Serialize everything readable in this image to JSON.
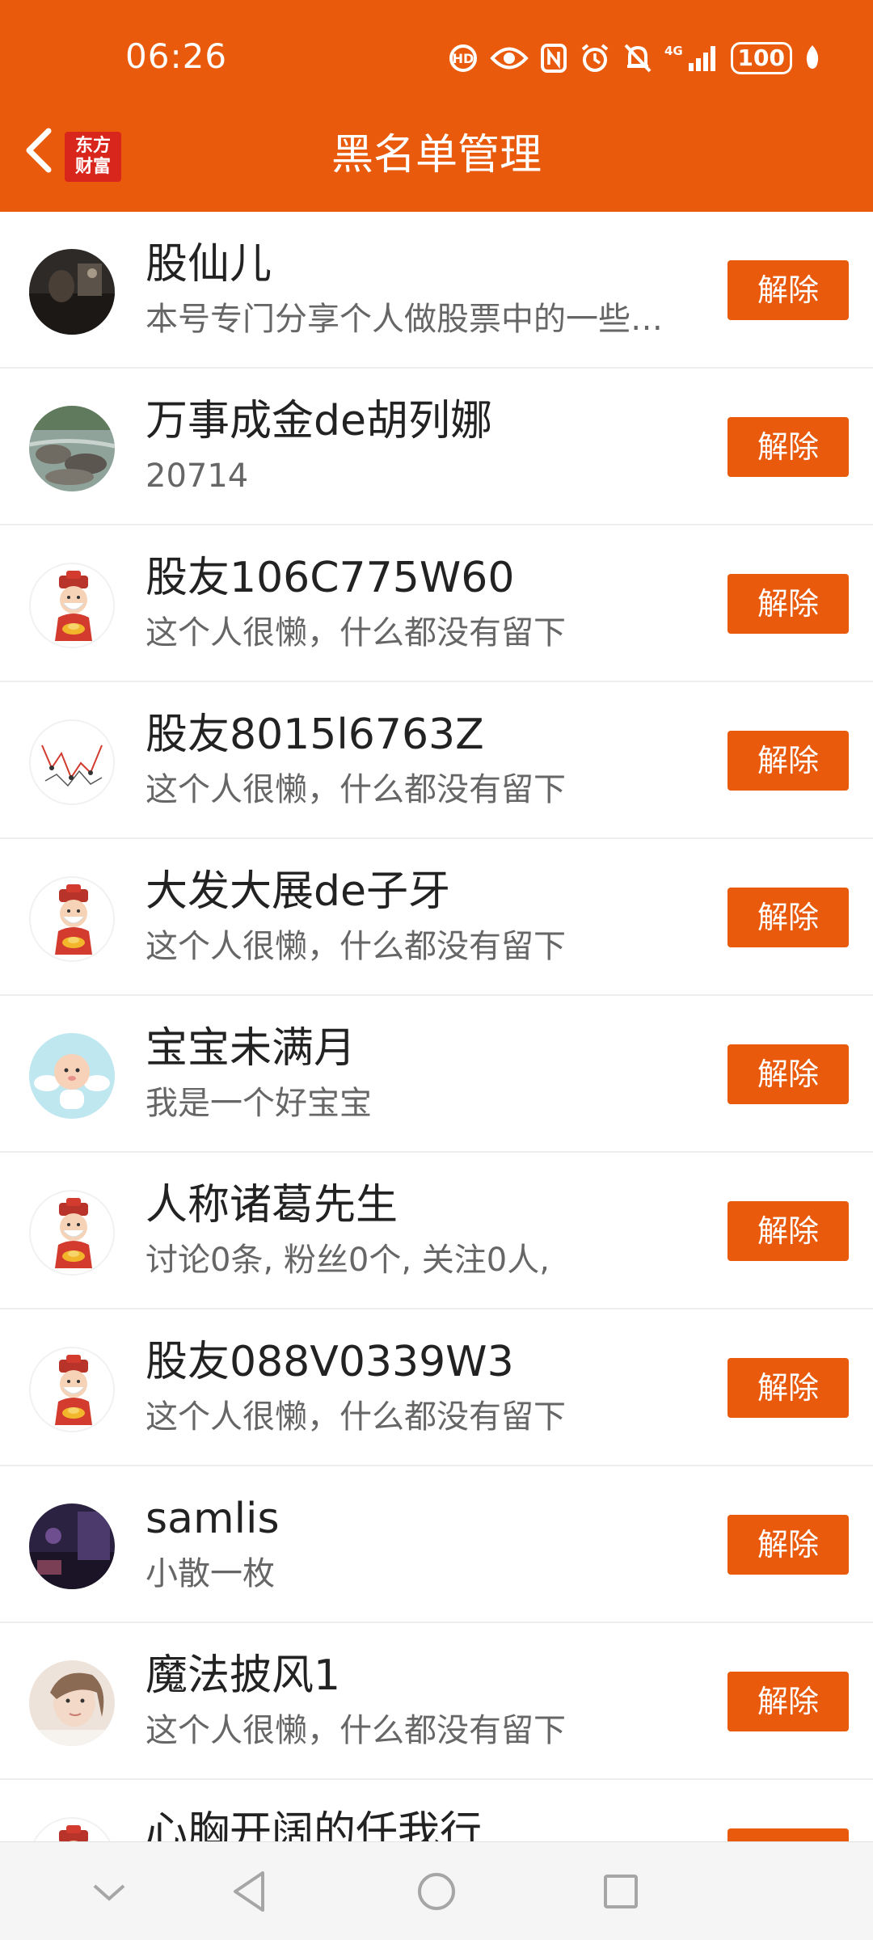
{
  "status_bar": {
    "time": "06:26",
    "battery": "100",
    "icons": [
      "hd-call-icon",
      "eye-icon",
      "nfc-icon",
      "alarm-icon",
      "mute-bell-icon",
      "signal-4g-icon",
      "battery-icon",
      "leaf-icon"
    ]
  },
  "header": {
    "title": "黑名单管理",
    "logo_line1": "东方",
    "logo_line2": "财富",
    "back_icon": "chevron-left-icon"
  },
  "colors": {
    "brand_orange": "#E95A0C",
    "logo_red": "#D9261C",
    "name_text": "#222222",
    "desc_text": "#666666"
  },
  "list": {
    "unblock_label": "解除",
    "rows": [
      {
        "name": "股仙儿",
        "desc": "本号专门分享个人做股票中的一些…",
        "avatar": "dark-photo"
      },
      {
        "name": "万事成金de胡列娜",
        "desc": "20714",
        "avatar": "river-photo"
      },
      {
        "name": "股友106C775W60",
        "desc": "这个人很懒，什么都没有留下",
        "avatar": "caishen-default"
      },
      {
        "name": "股友8015l6763Z",
        "desc": "这个人很懒，什么都没有留下",
        "avatar": "chart-sketch"
      },
      {
        "name": "大发大展de子牙",
        "desc": "这个人很懒，什么都没有留下",
        "avatar": "caishen-default"
      },
      {
        "name": "宝宝未满月",
        "desc": "我是一个好宝宝",
        "avatar": "baby-angel"
      },
      {
        "name": "人称诸葛先生",
        "desc": "讨论0条, 粉丝0个, 关注0人,",
        "avatar": "caishen-default"
      },
      {
        "name": "股友088V0339W3",
        "desc": "这个人很懒，什么都没有留下",
        "avatar": "caishen-default"
      },
      {
        "name": "samlis",
        "desc": "小散一枚",
        "avatar": "night-photo"
      },
      {
        "name": "魔法披风1",
        "desc": "这个人很懒，什么都没有留下",
        "avatar": "girl-photo"
      },
      {
        "name": "心胸开阔的任我行",
        "desc": "",
        "avatar": "caishen-default"
      }
    ]
  },
  "navbar": {
    "icons": [
      "hide-keyboard-icon",
      "back-triangle-icon",
      "home-circle-icon",
      "recents-square-icon"
    ]
  }
}
